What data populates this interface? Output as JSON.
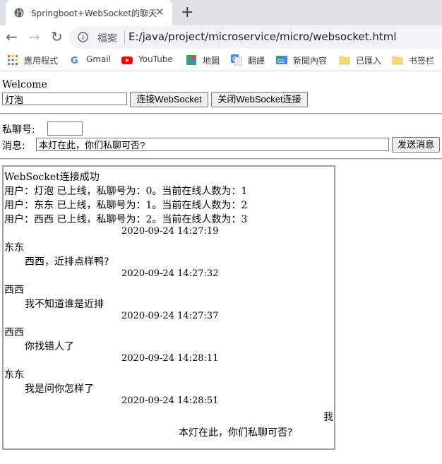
{
  "browser": {
    "tab": {
      "title": "Springboot+WebSocket的聊天",
      "close": "✕"
    },
    "new_tab": "+",
    "nav": {
      "back": "←",
      "forward": "→",
      "reload": "↻"
    },
    "address": {
      "scheme_label": "檔案",
      "url": "E:/java/project/microservice/micro/websocket.html"
    },
    "bookmarks": [
      {
        "label": "應用程式",
        "icon": "apps-grid-icon"
      },
      {
        "label": "Gmail",
        "icon": "google-icon"
      },
      {
        "label": "YouTube",
        "icon": "youtube-icon"
      },
      {
        "label": "地圖",
        "icon": "maps-icon"
      },
      {
        "label": "翻譯",
        "icon": "translate-icon"
      },
      {
        "label": "新聞內容",
        "icon": "news-icon"
      },
      {
        "label": "已匯入",
        "icon": "folder-icon"
      },
      {
        "label": "书签栏",
        "icon": "folder-icon"
      }
    ]
  },
  "page": {
    "welcome": "Welcome",
    "nickname_value": "灯泡",
    "connect_button": "连接WebSocket",
    "close_button": "关闭WebSocket连接",
    "private_label": "私聊号:",
    "private_value": "",
    "message_label": "消息:",
    "message_value": "本灯在此，你们私聊可否?",
    "send_button": "发送消息"
  },
  "messages": {
    "status": "WebSocket连接成功",
    "online": [
      "用户：灯泡 已上线，私聊号为：0。当前在线人数为：1",
      "用户：东东 已上线，私聊号为：1。当前在线人数为：2",
      "用户：西西 已上线，私聊号为：2。当前在线人数为：3"
    ],
    "chats": [
      {
        "time": "2020-09-24 14:27:19",
        "sender": "东东",
        "text": "西西，近排点样鸭?"
      },
      {
        "time": "2020-09-24 14:27:32",
        "sender": "西西",
        "text": "我不知道谁是近排"
      },
      {
        "time": "2020-09-24 14:27:37",
        "sender": "西西",
        "text": "你找错人了"
      },
      {
        "time": "2020-09-24 14:28:11",
        "sender": "东东",
        "text": "我是问你怎样了"
      }
    ],
    "self_message": {
      "time": "2020-09-24 14:28:51",
      "sender": "我",
      "text": "本灯在此，你们私聊可否?"
    }
  },
  "colors": {
    "tabstrip": "#dee1e6",
    "omnibox": "#f1f3f4",
    "youtube_red": "#ff0000",
    "folder_yellow": "#f8d775",
    "border": "#a0a0a0"
  }
}
